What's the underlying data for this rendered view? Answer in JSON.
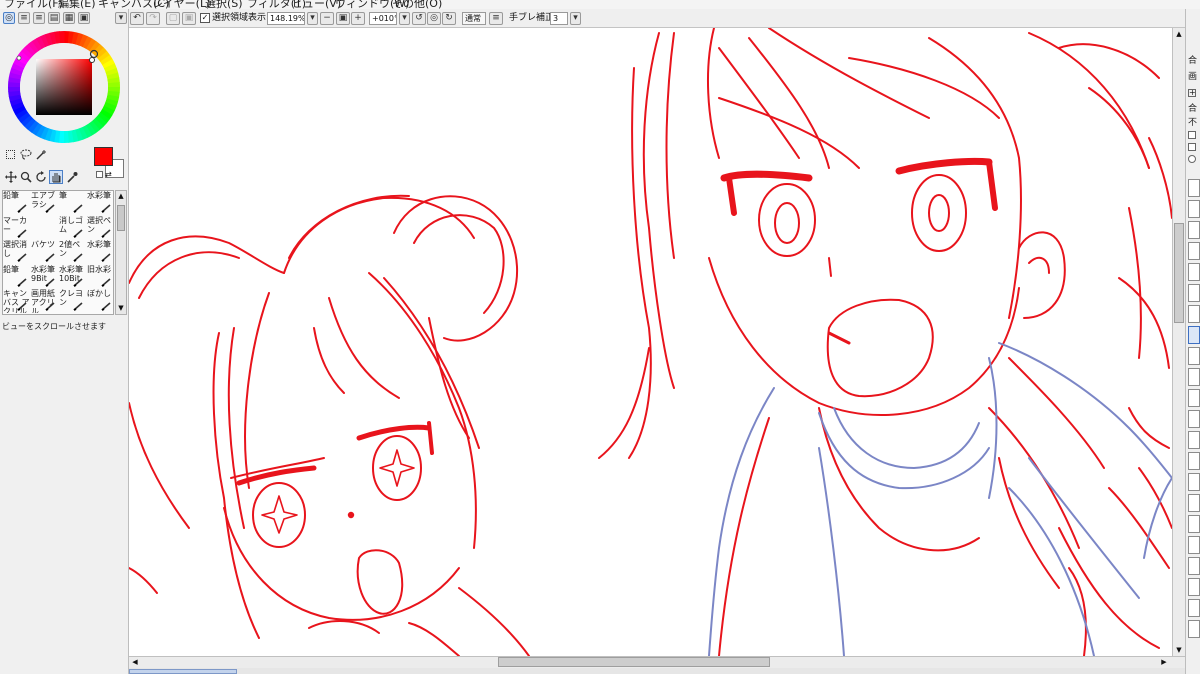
{
  "menu": [
    "ファイル(F)",
    "編集(E)",
    "キャンバス(C)",
    "レイヤー(L)",
    "選択(S)",
    "フィルタ(T)",
    "ビュー(V)",
    "ウィンドウ(W)",
    "その他(O)"
  ],
  "left_panel": {
    "brushes": [
      {
        "label": "鉛筆",
        "icon": "pencil-icon"
      },
      {
        "label": "エアブラシ",
        "icon": "airbrush-icon"
      },
      {
        "label": "筆",
        "icon": "brush-icon"
      },
      {
        "label": "水彩筆",
        "icon": "watercolor-icon"
      },
      {
        "label": "マーカー",
        "icon": "marker-icon"
      },
      {
        "label": "",
        "icon": ""
      },
      {
        "label": "消しゴム",
        "icon": "eraser-icon"
      },
      {
        "label": "選択ペン",
        "icon": "select-pen-icon"
      },
      {
        "label": "選択消し",
        "icon": "select-erase-icon"
      },
      {
        "label": "バケツ",
        "icon": "bucket-icon"
      },
      {
        "label": "2値ペン",
        "icon": "binary-pen-icon"
      },
      {
        "label": "水彩筆",
        "icon": "watercolor-icon"
      },
      {
        "label": "鉛筆",
        "icon": "pencil-icon"
      },
      {
        "label": "水彩筆 9Bit",
        "icon": "watercolor-icon"
      },
      {
        "label": "水彩筆 10Bit",
        "icon": "watercolor-icon"
      },
      {
        "label": "旧水彩",
        "icon": "old-watercolor-icon"
      },
      {
        "label": "キャンバス アクリル",
        "icon": "acrylic-icon"
      },
      {
        "label": "画用紙 アクリル",
        "icon": "acrylic-icon"
      },
      {
        "label": "クレヨン",
        "icon": "crayon-icon"
      },
      {
        "label": "ぼかし",
        "icon": "blur-icon"
      }
    ],
    "status_text": "ビューをスクロールさせます",
    "main_color": "#ff0000",
    "sub_color": "#ffffff"
  },
  "toolbar": {
    "selection_checkbox_label": "選択領域表示",
    "selection_checked": true,
    "zoom": "148.19%",
    "rotation": "+010°",
    "blend_mode": "通常",
    "stabilizer_label": "手ブレ補正",
    "stabilizer_value": "3"
  },
  "canvas": {
    "line_color": "#e8141c",
    "sub_line_color": "#7b86c6",
    "paper_color": "#ffffff"
  },
  "right_panel": {
    "labels": [
      "合",
      "画",
      "合",
      "不"
    ]
  }
}
